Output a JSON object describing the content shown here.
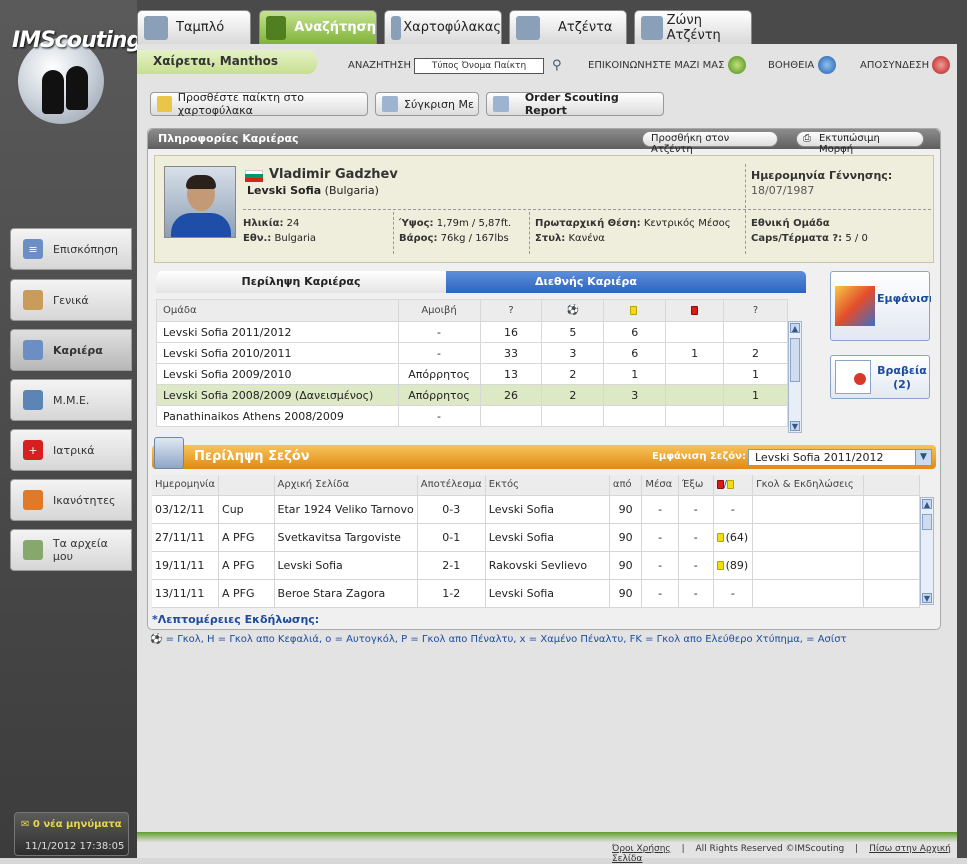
{
  "colors": {
    "accent_green": "#7fb33a",
    "orange": "#e08a12",
    "blue": "#2d63c2"
  },
  "logo": {
    "text": "IMScouting"
  },
  "tabs": [
    {
      "label": "Ταμπλό",
      "icon": "dashboard-icon"
    },
    {
      "label": "Αναζήτηση",
      "icon": "search-people-icon"
    },
    {
      "label": "Χαρτοφύλακας",
      "icon": "portfolio-icon"
    },
    {
      "label": "Ατζέντα",
      "icon": "agenda-icon"
    },
    {
      "label": "Ζώνη Ατζέντη",
      "icon": "agent-zone-icon"
    }
  ],
  "greeting": "Χαίρεται, Manthos",
  "topbar": {
    "search_label": "ΑΝΑΖΗΤΗΣΗ",
    "search_placeholder": "Τύπος Όνομα Παίκτη",
    "contact": "ΕΠΙΚΟΙΝΩΝΗΣΤΕ ΜΑΖΙ ΜΑΣ",
    "help": "ΒΟΗΘΕΙΑ",
    "logout": "ΑΠΟΣΥΝΔΕΣΗ"
  },
  "actions": {
    "add_portfolio": "Προσθέστε παίκτη στο χαρτοφύλακα",
    "compare": "Σύγκριση Με",
    "order_report": "Order Scouting Report"
  },
  "sidebar": {
    "items": [
      {
        "label": "Επισκόπηση",
        "icon": "overview-icon"
      },
      {
        "label": "Γενικά",
        "icon": "general-icon"
      },
      {
        "label": "Καριέρα",
        "icon": "career-icon"
      },
      {
        "label": "Μ.Μ.Ε.",
        "icon": "media-icon"
      },
      {
        "label": "Ιατρικά",
        "icon": "medical-icon"
      },
      {
        "label": "Ικανότητες",
        "icon": "skills-icon"
      },
      {
        "label": "Τα αρχεία μου",
        "icon": "files-icon"
      }
    ],
    "messages": "0 νέα μηνύματα",
    "datetime": "11/1/2012 17:38:05"
  },
  "panel": {
    "title": "Πληροφορίες Καριέρας",
    "add_agenda": "Προσθήκη στον Ατζέντη",
    "print": "Εκτυπώσιμη Μορφή"
  },
  "player": {
    "name": "Vladimir Gadzhev",
    "club": "Levski Sofia",
    "club_country": "(Bulgaria)",
    "birth_label": "Ημερομηνία Γέννησης:",
    "birth": "18/07/1987",
    "age_label": "Ηλικία:",
    "age": "24",
    "nat_label": "Εθν.:",
    "nat": "Bulgaria",
    "height_label": "Ύψος:",
    "height": "1,79m / 5,87ft.",
    "weight_label": "Βάρος:",
    "weight": "76kg / 167lbs",
    "position_label": "Πρωταρχική Θέση:",
    "position": "Κεντρικός Μέσος",
    "style_label": "Στυλ:",
    "style": "Κανένα",
    "national_label": "Εθνική Ομάδα",
    "caps_label": "Caps/Τέρματα ?:",
    "caps": "5 / 0"
  },
  "career": {
    "tab1": "Περίληψη Καριέρας",
    "tab2": "Διεθνής Καριέρα",
    "headers": [
      "Ομάδα",
      "Αμοιβή",
      "?",
      "⚽",
      "",
      "",
      "?"
    ],
    "rows": [
      [
        "Levski Sofia 2011/2012",
        "-",
        "16",
        "5",
        "6",
        "",
        ""
      ],
      [
        "Levski Sofia 2010/2011",
        "-",
        "33",
        "3",
        "6",
        "1",
        "2"
      ],
      [
        "Levski Sofia 2009/2010",
        "Απόρρητος",
        "13",
        "2",
        "1",
        "",
        "1"
      ],
      [
        "Levski Sofia 2008/2009 (Δανεισμένος)",
        "Απόρρητος",
        "26",
        "2",
        "3",
        "",
        "1"
      ],
      [
        "Panathinaikos Athens 2008/2009",
        "-",
        "",
        "",
        "",
        "",
        ""
      ]
    ]
  },
  "side_cards": {
    "graph": "Εμφάνιση γραφήματ",
    "awards": "Βραβεία",
    "awards_count": "(2)"
  },
  "season": {
    "title": "Περίληψη Σεζόν",
    "show_label": "Εμφάνιση Σεζόν:",
    "selected": "Levski Sofia 2011/2012",
    "headers": [
      "Ημερομηνία",
      "",
      "Αρχική Σελίδα",
      "Αποτέλεσμα",
      "Εκτός",
      "από",
      "Μέσα",
      "Έξω",
      "",
      "Γκολ & Εκδηλώσεις"
    ],
    "rows": [
      [
        "03/12/11",
        "Cup",
        "Etar 1924 Veliko Tarnovo",
        "0-3",
        "Levski Sofia",
        "90",
        "-",
        "-",
        "-"
      ],
      [
        "27/11/11",
        "A PFG",
        "Svetkavitsa Targoviste",
        "0-1",
        "Levski Sofia",
        "90",
        "-",
        "-",
        "(64)"
      ],
      [
        "19/11/11",
        "A PFG",
        "Levski Sofia",
        "2-1",
        "Rakovski Sevlievo",
        "90",
        "-",
        "-",
        "(89)"
      ],
      [
        "13/11/11",
        "A PFG",
        "Beroe Stara Zagora",
        "1-2",
        "Levski Sofia",
        "90",
        "-",
        "-",
        "-"
      ]
    ]
  },
  "details_label": "*Λεπτομέρειες Εκδήλωσης:",
  "legend": "= Γκολ, H = Γκολ απο Κεφαλιά, o = Αυτογκόλ, P = Γκολ απο Πέναλτυ, x = Χαμένο Πέναλτυ, FK = Γκολ απο Ελεύθερο Χτύπημα, = Ασίστ",
  "footer": {
    "terms": "Όροι Χρήσης",
    "rights": "All Rights Reserved ©IMScouting",
    "back": "Πίσω στην Αρχική Σελίδα"
  }
}
